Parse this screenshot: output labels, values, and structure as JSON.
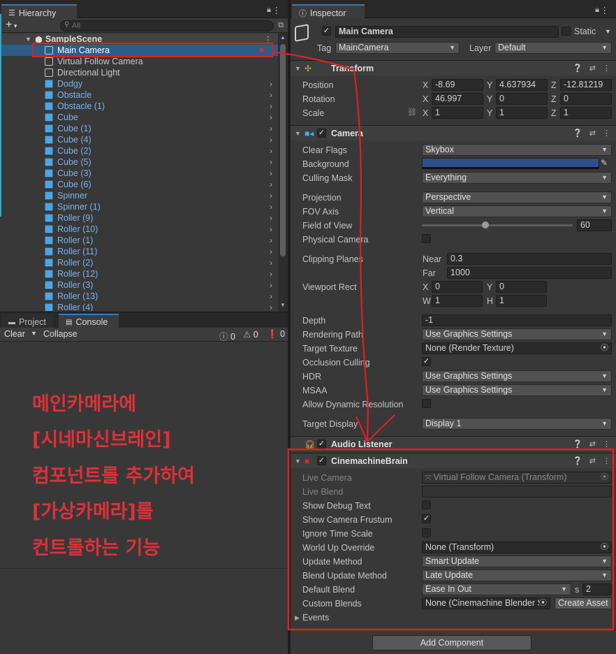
{
  "hierarchy": {
    "tab_label": "Hierarchy",
    "search_placeholder": "All",
    "scene_name": "SampleScene",
    "items": [
      {
        "label": "Main Camera"
      },
      {
        "label": "Virtual Follow Camera"
      },
      {
        "label": "Directional Light"
      },
      {
        "label": "Dodgy"
      },
      {
        "label": "Obstacle"
      },
      {
        "label": "Obstacle (1)"
      },
      {
        "label": "Cube"
      },
      {
        "label": "Cube (1)"
      },
      {
        "label": "Cube (4)"
      },
      {
        "label": "Cube (2)"
      },
      {
        "label": "Cube (5)"
      },
      {
        "label": "Cube (3)"
      },
      {
        "label": "Cube (6)"
      },
      {
        "label": "Spinner"
      },
      {
        "label": "Spinner (1)"
      },
      {
        "label": "Roller (9)"
      },
      {
        "label": "Roller (10)"
      },
      {
        "label": "Roller (1)"
      },
      {
        "label": "Roller (11)"
      },
      {
        "label": "Roller (2)"
      },
      {
        "label": "Roller (12)"
      },
      {
        "label": "Roller (3)"
      },
      {
        "label": "Roller (13)"
      },
      {
        "label": "Roller (4)"
      }
    ]
  },
  "console": {
    "project_tab": "Project",
    "console_tab": "Console",
    "clear": "Clear",
    "collapse": "Collapse",
    "info_count": "0",
    "warn_count": "0",
    "error_count": "0"
  },
  "annotation": {
    "lines": [
      "메인카메라에",
      "[시네마신브레인]",
      "컴포넌트를 추가하여",
      "[가상카메라]를",
      "컨트롤하는 기능"
    ],
    "color": "#e03038"
  },
  "inspector": {
    "tab_label": "Inspector",
    "object_name": "Main Camera",
    "static_label": "Static",
    "tag_label": "Tag",
    "tag_value": "MainCamera",
    "layer_label": "Layer",
    "layer_value": "Default",
    "transform": {
      "title": "Transform",
      "position_label": "Position",
      "rotation_label": "Rotation",
      "scale_label": "Scale",
      "position": {
        "x": "-8.69",
        "y": "4.637934",
        "z": "-12.81219"
      },
      "rotation": {
        "x": "46.997",
        "y": "0",
        "z": "0"
      },
      "scale": {
        "x": "1",
        "y": "1",
        "z": "1"
      }
    },
    "camera": {
      "title": "Camera",
      "clear_flags_label": "Clear Flags",
      "clear_flags": "Skybox",
      "background_label": "Background",
      "background_color": "#2f4f8a",
      "culling_mask_label": "Culling Mask",
      "culling_mask": "Everything",
      "projection_label": "Projection",
      "projection": "Perspective",
      "fov_axis_label": "FOV Axis",
      "fov_axis": "Vertical",
      "fov_label": "Field of View",
      "fov_value": "60",
      "fov_fraction": 0.42,
      "physical_label": "Physical Camera",
      "clipping_label": "Clipping Planes",
      "near_label": "Near",
      "near": "0.3",
      "far_label": "Far",
      "far": "1000",
      "viewport_label": "Viewport Rect",
      "vx": "0",
      "vy": "0",
      "vw": "1",
      "vh": "1",
      "depth_label": "Depth",
      "depth": "-1",
      "rendering_path_label": "Rendering Path",
      "rendering_path": "Use Graphics Settings",
      "target_texture_label": "Target Texture",
      "target_texture": "None (Render Texture)",
      "occlusion_label": "Occlusion Culling",
      "hdr_label": "HDR",
      "hdr": "Use Graphics Settings",
      "msaa_label": "MSAA",
      "msaa": "Use Graphics Settings",
      "dyn_res_label": "Allow Dynamic Resolution",
      "target_display_label": "Target Display",
      "target_display": "Display 1"
    },
    "audio_listener": {
      "title": "Audio Listener"
    },
    "brain": {
      "title": "CinemachineBrain",
      "live_camera_label": "Live Camera",
      "live_camera": "Virtual Follow Camera (Transform)",
      "live_blend_label": "Live Blend",
      "debug_label": "Show Debug Text",
      "frustum_label": "Show Camera Frustum",
      "ignore_time_label": "Ignore Time Scale",
      "world_up_label": "World Up Override",
      "world_up": "None (Transform)",
      "update_method_label": "Update Method",
      "update_method": "Smart Update",
      "blend_update_label": "Blend Update Method",
      "blend_update": "Late Update",
      "default_blend_label": "Default Blend",
      "default_blend": "Ease In Out",
      "blend_s_label": "s",
      "blend_time": "2",
      "custom_blends_label": "Custom Blends",
      "custom_blends": "None (Cinemachine Blender S",
      "create_asset": "Create Asset",
      "events_label": "Events"
    },
    "add_component": "Add Component"
  }
}
